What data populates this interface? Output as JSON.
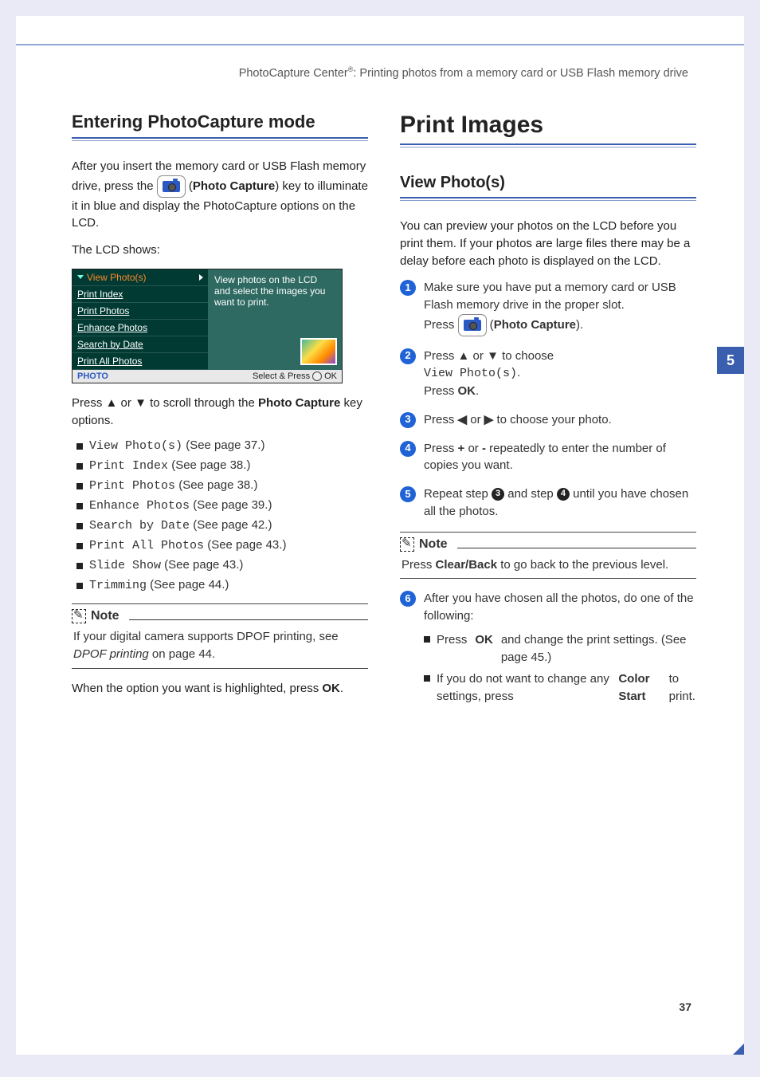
{
  "header": {
    "left": "PhotoCapture Center",
    "sup": "®",
    "right": ": Printing photos from a memory card or USB Flash memory drive"
  },
  "side_tab": "5",
  "page_number": "37",
  "left": {
    "h2": "Entering PhotoCapture mode",
    "p1a": "After you insert the memory card or USB Flash memory drive, press the ",
    "p1b": " (",
    "p1c": "Photo Capture",
    "p1d": ") key to illuminate it in blue and display the PhotoCapture options on the LCD.",
    "p2": "The LCD shows:",
    "lcd": {
      "selected": "View Photo(s)",
      "items": [
        "Print Index",
        "Print Photos",
        "Enhance Photos",
        "Search by Date",
        "Print All Photos"
      ],
      "desc": "View photos on the LCD and select the images you want to print.",
      "foot_left": "PHOTO",
      "foot_right_a": "Select & Press",
      "foot_right_b": "OK"
    },
    "p3a": "Press ",
    "p3_up": "▲",
    "p3_or": " or ",
    "p3_dn": "▼",
    "p3b": " to scroll through the ",
    "p3c": "Photo Capture",
    "p3d": " key options.",
    "opts": [
      {
        "m": "View Photo(s)",
        "t": " (See page 37.)"
      },
      {
        "m": "Print Index",
        "t": " (See page 38.)"
      },
      {
        "m": "Print Photos",
        "t": " (See page 38.)"
      },
      {
        "m": "Enhance Photos",
        "t": " (See page 39.)"
      },
      {
        "m": "Search by Date",
        "t": " (See page 42.)"
      },
      {
        "m": "Print All Photos",
        "t": " (See page 43.)"
      },
      {
        "m": "Slide Show",
        "t": " (See page 43.)"
      },
      {
        "m": "Trimming",
        "t": " (See page 44.)"
      }
    ],
    "note_label": "Note",
    "note_body_a": "If your digital camera supports DPOF printing, see ",
    "note_body_i": "DPOF printing",
    "note_body_b": " on page 44.",
    "p4a": "When the option you want is highlighted, press ",
    "p4b": "OK",
    "p4c": "."
  },
  "right": {
    "h1": "Print Images",
    "h3": "View Photo(s)",
    "intro": "You can preview your photos on the LCD before you print them. If your photos are large files there may be a delay before each photo is displayed on the LCD.",
    "steps": {
      "s1a": "Make sure you have put a memory card or USB Flash memory drive in the proper slot.",
      "s1b_a": "Press ",
      "s1b_b": " (",
      "s1b_c": "Photo Capture",
      "s1b_d": ").",
      "s2a": "Press ",
      "s2_up": "▲",
      "s2_or": " or ",
      "s2_dn": "▼",
      "s2b": " to choose ",
      "s2c": "View Photo(s)",
      "s2d": ".",
      "s2e_a": "Press ",
      "s2e_b": "OK",
      "s2e_c": ".",
      "s3a": "Press ",
      "s3_l": "◀",
      "s3_or": " or ",
      "s3_r": "▶",
      "s3b": " to choose your photo.",
      "s4a": "Press ",
      "s4_plus": "+",
      "s4_or": " or ",
      "s4_minus": "-",
      "s4b": " repeatedly to enter the number of copies you want.",
      "s5a": "Repeat step ",
      "s5_ref1": "3",
      "s5_mid": " and step ",
      "s5_ref2": "4",
      "s5b": " until you have chosen all the photos."
    },
    "note_label": "Note",
    "note_body_a": "Press ",
    "note_body_b": "Clear/Back",
    "note_body_c": " to go back to the previous level.",
    "s6a": "After you have chosen all the photos, do one of the following:",
    "s6_opt1_a": "Press ",
    "s6_opt1_b": "OK",
    "s6_opt1_c": " and change the print settings. (See page 45.)",
    "s6_opt2_a": "If you do not want to change any settings, press ",
    "s6_opt2_b": "Color Start",
    "s6_opt2_c": " to print."
  }
}
